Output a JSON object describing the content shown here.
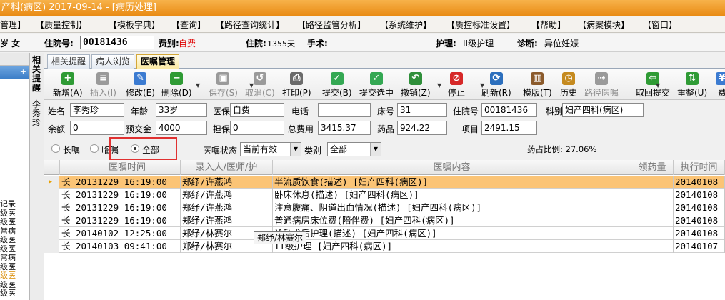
{
  "window": {
    "title": "产科(病区)  2017-09-14 - [病历处理]"
  },
  "menu": [
    "管理】",
    "【质量控制】",
    "【模板字典】",
    "【查询】",
    "【路径查询统计】",
    "【路径监管分析】",
    "【系统维护】",
    "【质控标准设置】",
    "【帮助】",
    "【病案模块】",
    "【窗口】"
  ],
  "patient_bar": {
    "age_sex": "岁  女",
    "admission_no_label": "住院号:",
    "admission_no": "00181436",
    "payment_label": "费别:",
    "payment": "自费",
    "stay_label": "住院:",
    "stay": "1355天",
    "surgery_label": "手术:",
    "nursing_label": "护理:",
    "nursing": "II级护理",
    "diagnosis_label": "诊断:",
    "diagnosis": "异位妊娠"
  },
  "left_pane": {
    "header": "",
    "bar_label": "+",
    "items": [
      "记录",
      "级医",
      "级医",
      "常病",
      "级医",
      "级医",
      "常病",
      "级医",
      "级医",
      "级医",
      "级医"
    ]
  },
  "vertical_tabs": {
    "related": "相关提醒",
    "patient_name": "李秀珍"
  },
  "tabs": [
    "相关提醒",
    "病人浏览",
    "医嘱管理"
  ],
  "toolbar": [
    {
      "label": "新增(A)",
      "icon": "add-icon",
      "color": "#2f9b35",
      "glyph": "+",
      "disabled": false
    },
    {
      "label": "插入(I)",
      "icon": "insert-icon",
      "color": "#9a9a9a",
      "glyph": "≡",
      "disabled": true
    },
    {
      "label": "修改(E)",
      "icon": "edit-icon",
      "color": "#3b7bd1",
      "glyph": "✎",
      "disabled": false
    },
    {
      "label": "删除(D)",
      "icon": "delete-icon",
      "color": "#2f9b35",
      "glyph": "−",
      "disabled": false
    },
    {
      "label": "保存(S)",
      "icon": "save-icon",
      "color": "#9a9a9a",
      "glyph": "▣",
      "disabled": true
    },
    {
      "label": "取消(C)",
      "icon": "cancel-icon",
      "color": "#9a9a9a",
      "glyph": "↺",
      "disabled": true
    },
    {
      "label": "打印(P)",
      "icon": "print-icon",
      "color": "#6b6b6b",
      "glyph": "⎙",
      "disabled": false
    },
    {
      "label": "提交(B)",
      "icon": "submit-icon",
      "color": "#34a853",
      "glyph": "✓",
      "disabled": false
    },
    {
      "label": "提交选中",
      "icon": "submit-selected-icon",
      "color": "#34a853",
      "glyph": "✓",
      "disabled": false
    },
    {
      "label": "撤销(Z)",
      "icon": "undo-icon",
      "color": "#2f8f3a",
      "glyph": "↶",
      "disabled": false
    },
    {
      "label": "停止",
      "icon": "stop-icon",
      "color": "#d62828",
      "glyph": "⊘",
      "disabled": false
    },
    {
      "label": "刷新(R)",
      "icon": "refresh-icon",
      "color": "#2c6fbd",
      "glyph": "⟳",
      "disabled": false
    },
    {
      "label": "模版(T)",
      "icon": "template-icon",
      "color": "#8b5a2b",
      "glyph": "▥",
      "disabled": false
    },
    {
      "label": "历史",
      "icon": "history-icon",
      "color": "#c58a1f",
      "glyph": "◷",
      "disabled": false
    },
    {
      "label": "路径医嘱",
      "icon": "pathway-order-icon",
      "color": "#9a9a9a",
      "glyph": "⇢",
      "disabled": true
    },
    {
      "label": "取回提交",
      "icon": "retrieve-icon",
      "color": "#2f9b35",
      "glyph": "⇦",
      "disabled": false
    },
    {
      "label": "重整(U)",
      "icon": "reorganize-icon",
      "color": "#2f9b35",
      "glyph": "⇅",
      "disabled": false
    },
    {
      "label": "费",
      "icon": "fee-icon",
      "color": "#3b7bd1",
      "glyph": "¥",
      "disabled": false
    }
  ],
  "patient": {
    "name_label": "姓名",
    "name": "李秀珍",
    "age_label": "年龄",
    "age": "33岁",
    "insurance_label": "医保",
    "insurance": "自费",
    "phone_label": "电话",
    "phone": "",
    "bed_label": "床号",
    "bed": "31",
    "admission_label": "住院号",
    "admission": "00181436",
    "dept_label": "科别",
    "dept": "妇产四科(病区)",
    "balance_label": "余额",
    "balance": "0",
    "prepaid_label": "预交金",
    "prepaid": "4000",
    "guarantee_label": "担保",
    "guarantee": "0",
    "total_label": "总费用",
    "total": "3415.37",
    "drug_label": "药品",
    "drug": "924.22",
    "item_label": "项目",
    "item": "2491.15"
  },
  "filter": {
    "long_term": "长嘱",
    "temporary": "临嘱",
    "all": "全部",
    "status_label": "医嘱状态",
    "status_value": "当前有效",
    "category_label": "类别",
    "category_value": "全部",
    "drug_ratio": "药占比例: 27.06%"
  },
  "grid": {
    "headers": [
      "医嘱时间",
      "录入人/医师/护",
      "医嘱内容",
      "领药量",
      "执行时间"
    ],
    "rows": [
      {
        "type": "长",
        "time": "20131229 16:19:00",
        "by": "郑纾/许燕鸿",
        "content": "半流质饮食(描述)   [妇产四科(病区)]",
        "exec": "20140108"
      },
      {
        "type": "长",
        "time": "20131229 16:19:00",
        "by": "郑纾/许燕鸿",
        "content": "卧床休息(描述)   [妇产四科(病区)]",
        "exec": "20140108"
      },
      {
        "type": "长",
        "time": "20131229 16:19:00",
        "by": "郑纾/许燕鸿",
        "content": "注意腹痛、阴道出血情况(描述)   [妇产四科(病区)]",
        "exec": "20140108"
      },
      {
        "type": "长",
        "time": "20131229 16:19:00",
        "by": "郑纾/许燕鸿",
        "content": "普通病房床位费(陪伴费)   [妇产四科(病区)]",
        "exec": "20140108"
      },
      {
        "type": "长",
        "time": "20140102 12:25:00",
        "by": "郑纾/林赛尔",
        "content": "诊刮术后护理(描述)   [妇产四科(病区)]",
        "exec": "20140108"
      },
      {
        "type": "长",
        "time": "20140103 09:41:00",
        "by": "郑纾/林赛尔",
        "content": "II级护理   [妇产四科(病区)]",
        "exec": "20140107"
      }
    ]
  },
  "tooltip": "郑纾/林赛尔"
}
